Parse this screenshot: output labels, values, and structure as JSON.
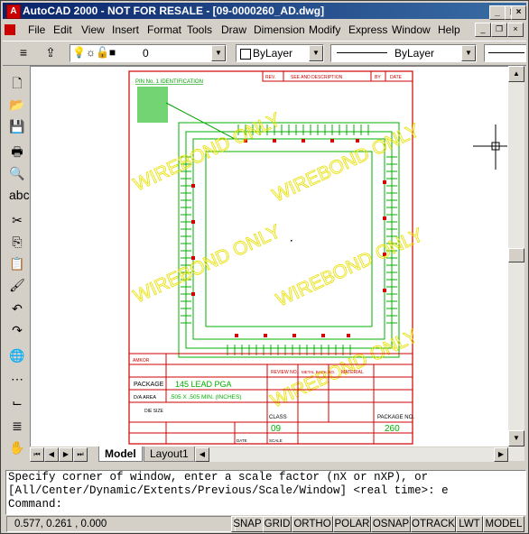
{
  "window": {
    "title": "AutoCAD 2000 - NOT FOR RESALE - [09-0000260_AD.dwg]"
  },
  "menu": [
    "File",
    "Edit",
    "View",
    "Insert",
    "Format",
    "Tools",
    "Draw",
    "Dimension",
    "Modify",
    "Express",
    "Window",
    "Help"
  ],
  "toolbar": {
    "layer_value": "0",
    "color_value": "ByLayer",
    "linetype_value": "ByLayer"
  },
  "drawing": {
    "pin1_label": "PIN No. 1 IDENTIFICATION",
    "rev_header": "REV.",
    "desc_header": "SEE AND DESCRIPTION",
    "by_header": "BY",
    "date_header": "DATE",
    "watermark": "WIREBOND ONLY",
    "company": "AMKOR",
    "package_label": "PACKAGE",
    "package_value": "145 LEAD PGA",
    "area_label": "D/A AREA",
    "area_value": ".505 X .505 MIN. (INCHES)",
    "die_size_label": "DIE SIZE",
    "class_label": "CLASS",
    "class_value": "09",
    "pkg_no_label": "PACKAGE NO.",
    "pkg_no_value": "260",
    "rev_no_label": "REVIEW NO.",
    "metal_label": "METAL BACK NO.",
    "material_label": "MATERIAL",
    "scale_label": "SCALE",
    "date_label": "DATE"
  },
  "layout_tabs": [
    "Model",
    "Layout1"
  ],
  "command": {
    "line1": "Specify corner of window, enter a scale factor (nX or nXP), or",
    "line2": "[All/Center/Dynamic/Extents/Previous/Scale/Window] <real time>: e",
    "prompt": "Command:"
  },
  "status": {
    "coords": "0.577, 0.261 , 0.000",
    "buttons": [
      "SNAP",
      "GRID",
      "ORTHO",
      "POLAR",
      "OSNAP",
      "OTRACK",
      "LWT",
      "MODEL"
    ]
  },
  "colors": {
    "title_bg": "#0a246a",
    "drawing_red": "#d00000",
    "drawing_green": "#00b000",
    "watermark": "#e8e000"
  }
}
